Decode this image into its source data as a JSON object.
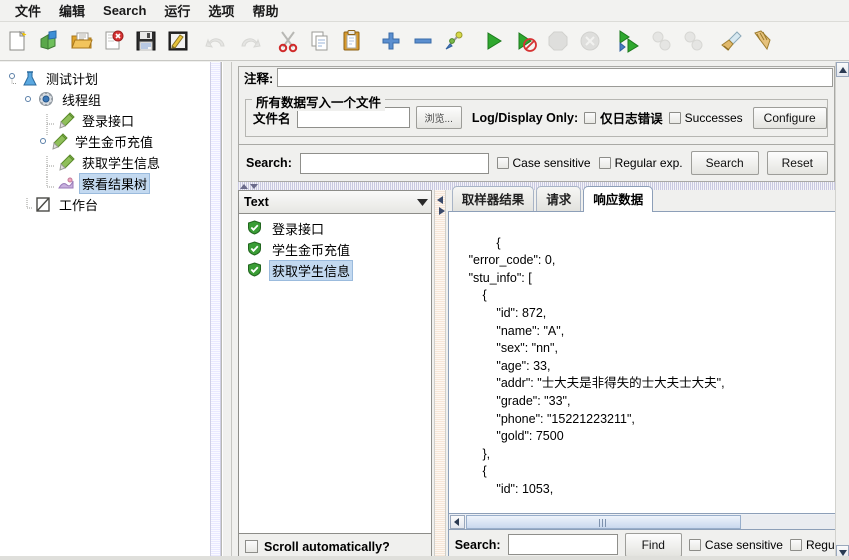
{
  "menu": {
    "items": [
      {
        "label": "文件",
        "name": "menu-file"
      },
      {
        "label": "编辑",
        "name": "menu-edit"
      },
      {
        "label": "Search",
        "name": "menu-search"
      },
      {
        "label": "运行",
        "name": "menu-run"
      },
      {
        "label": "选项",
        "name": "menu-options"
      },
      {
        "label": "帮助",
        "name": "menu-help"
      }
    ]
  },
  "toolbar": {
    "buttons": [
      {
        "icon": "new-document-icon",
        "disabled": false
      },
      {
        "icon": "new-template-icon",
        "disabled": false
      },
      {
        "icon": "open-folder-icon",
        "disabled": false
      },
      {
        "icon": "close-document-icon",
        "disabled": false
      },
      {
        "icon": "save-floppy-icon",
        "disabled": false
      },
      {
        "icon": "save-as-edit-icon",
        "disabled": false
      },
      {
        "icon": "undo-arrow-icon",
        "disabled": true
      },
      {
        "icon": "redo-arrow-icon",
        "disabled": true
      },
      {
        "icon": "cut-scissors-icon",
        "disabled": false
      },
      {
        "icon": "copy-pages-icon",
        "disabled": false
      },
      {
        "icon": "paste-clipboard-icon",
        "disabled": false
      },
      {
        "icon": "expand-plus-icon",
        "disabled": false
      },
      {
        "icon": "collapse-minus-icon",
        "disabled": false
      },
      {
        "icon": "toggle-element-icon",
        "disabled": false
      },
      {
        "icon": "start-play-icon",
        "disabled": false
      },
      {
        "icon": "start-no-pause-icon",
        "disabled": false
      },
      {
        "icon": "stop-octagon-icon",
        "disabled": true
      },
      {
        "icon": "shutdown-circle-icon",
        "disabled": true
      },
      {
        "icon": "start-remote-all-icon",
        "disabled": false
      },
      {
        "icon": "stop-remote-all-icon",
        "disabled": true
      },
      {
        "icon": "shutdown-remote-all-icon",
        "disabled": true
      },
      {
        "icon": "clear-broom-icon",
        "disabled": false
      },
      {
        "icon": "clear-all-broom-icon",
        "disabled": false
      }
    ]
  },
  "tree": {
    "nodes": [
      {
        "label": "测试计划",
        "icon": "test-plan-flask-icon",
        "depth": 0,
        "selected": false,
        "handle": true
      },
      {
        "label": "线程组",
        "icon": "thread-group-gear-icon",
        "depth": 1,
        "selected": false,
        "handle": true
      },
      {
        "label": "登录接口",
        "icon": "http-sampler-pen-icon",
        "depth": 2,
        "selected": false,
        "handle": false
      },
      {
        "label": "学生金币充值",
        "icon": "http-sampler-pen-icon",
        "depth": 2,
        "selected": false,
        "handle": true
      },
      {
        "label": "获取学生信息",
        "icon": "http-sampler-pen-icon",
        "depth": 2,
        "selected": false,
        "handle": false
      },
      {
        "label": "察看结果树",
        "icon": "view-results-tree-icon",
        "depth": 2,
        "selected": true,
        "handle": false
      },
      {
        "label": "工作台",
        "icon": "workbench-icon",
        "depth": 0,
        "selected": false,
        "handle": false
      }
    ]
  },
  "comment": {
    "label": "注释:",
    "value": "",
    "placeholder": ""
  },
  "write_all_data": {
    "legend": "所有数据写入一个文件",
    "filename_label": "文件名",
    "filename_value": "",
    "browse_button": "浏览...",
    "log_display_only_label": "Log/Display Only:",
    "errors_only_label": "仅日志错误",
    "successes_label": "Successes",
    "configure_button": "Configure"
  },
  "top_search": {
    "label": "Search:",
    "value": "",
    "case_sensitive_label": "Case sensitive",
    "regular_exp_label": "Regular exp.",
    "search_button": "Search",
    "reset_button": "Reset"
  },
  "results": {
    "render_combo_value": "Text",
    "nodes": [
      {
        "label": "登录接口",
        "status": "success",
        "selected": false
      },
      {
        "label": "学生金币充值",
        "status": "success",
        "selected": false
      },
      {
        "label": "获取学生信息",
        "status": "success",
        "selected": true
      }
    ],
    "scroll_automatically_label": "Scroll automatically?"
  },
  "detail": {
    "tabs": [
      {
        "label": "取样器结果",
        "active": false
      },
      {
        "label": "请求",
        "active": false
      },
      {
        "label": "响应数据",
        "active": true
      }
    ],
    "response_text": "{\n    \"error_code\": 0,\n    \"stu_info\": [\n        {\n            \"id\": 872,\n            \"name\": \"A\",\n            \"sex\": \"nn\",\n            \"age\": 33,\n            \"addr\": \"士大夫是非得失的士大夫士大夫\",\n            \"grade\": \"33\",\n            \"phone\": \"15221223211\",\n            \"gold\": 7500\n        },\n        {\n            \"id\": 1053,"
  },
  "bottom_search": {
    "label": "Search:",
    "value": "",
    "find_button": "Find",
    "case_sensitive_label": "Case sensitive",
    "regular_exp_label": "Regular"
  },
  "colors": {
    "accent_selection": "#c3d9f0",
    "panel_bg": "#f0f0ee",
    "success_green": "#3a9d35",
    "tab_border": "#8d9fb8"
  }
}
